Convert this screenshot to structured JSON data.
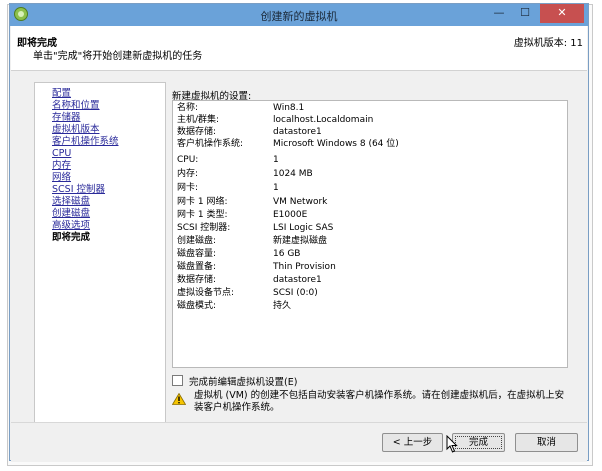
{
  "window": {
    "title": "创建新的虚拟机",
    "controls": {
      "minimize": "—",
      "maximize": "☐",
      "close": "✕"
    }
  },
  "header": {
    "title": "即将完成",
    "subtitle": "单击\"完成\"将开始创建新虚拟机的任务",
    "version": "虚拟机版本: 11"
  },
  "nav": {
    "items": [
      {
        "label": "配置",
        "current": false
      },
      {
        "label": "名称和位置",
        "current": false
      },
      {
        "label": "存储器",
        "current": false
      },
      {
        "label": "虚拟机版本",
        "current": false
      },
      {
        "label": "客户机操作系统",
        "current": false
      },
      {
        "label": "CPU",
        "current": false
      },
      {
        "label": "内存",
        "current": false
      },
      {
        "label": "网络",
        "current": false
      },
      {
        "label": "SCSI 控制器",
        "current": false
      },
      {
        "label": "选择磁盘",
        "current": false
      },
      {
        "label": "创建磁盘",
        "current": false
      },
      {
        "label": "高级选项",
        "current": false
      },
      {
        "label": "即将完成",
        "current": true
      }
    ]
  },
  "summary": {
    "label": "新建虚拟机的设置:",
    "rows": [
      {
        "key": "名称:",
        "value": "Win8.1"
      },
      {
        "key": "主机/群集:",
        "value": "localhost.Localdomain"
      },
      {
        "key": "数据存储:",
        "value": "datastore1"
      },
      {
        "key": "客户机操作系统:",
        "value": "Microsoft Windows 8 (64 位)"
      },
      {
        "key": "CPU:",
        "value": "1"
      },
      {
        "key": "内存:",
        "value": "1024 MB"
      },
      {
        "key": "网卡:",
        "value": "1"
      },
      {
        "key": "网卡 1 网络:",
        "value": "VM Network"
      },
      {
        "key": "网卡 1 类型:",
        "value": "E1000E"
      },
      {
        "key": "SCSI 控制器:",
        "value": "LSI Logic SAS"
      },
      {
        "key": "创建磁盘:",
        "value": "新建虚拟磁盘"
      },
      {
        "key": "磁盘容量:",
        "value": "16 GB"
      },
      {
        "key": "磁盘置备:",
        "value": "Thin Provision"
      },
      {
        "key": "数据存储:",
        "value": "datastore1"
      },
      {
        "key": "虚拟设备节点:",
        "value": "SCSI (0:0)"
      },
      {
        "key": "磁盘模式:",
        "value": "持久"
      }
    ]
  },
  "edit_checkbox": {
    "label": "完成前编辑虚拟机设置(E)",
    "checked": false
  },
  "warning": {
    "icon": "warning-triangle-icon",
    "text": "虚拟机 (VM) 的创建不包括自动安装客户机操作系统。请在创建虚拟机后，在虚拟机上安装客户机操作系统。"
  },
  "buttons": {
    "back": "< 上一步",
    "finish": "完成",
    "cancel": "取消"
  },
  "colors": {
    "titlebar": "#6aa2d9",
    "close": "#c75050",
    "link": "#2a2a9a"
  }
}
